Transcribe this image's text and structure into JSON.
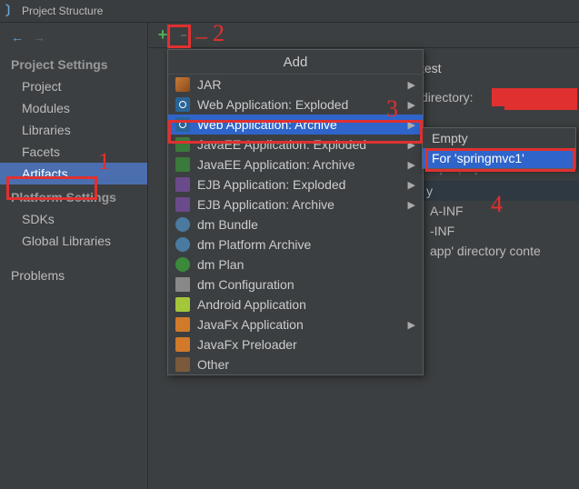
{
  "window": {
    "title": "Project Structure"
  },
  "sidebar": {
    "section1": "Project Settings",
    "items1": [
      "Project",
      "Modules",
      "Libraries",
      "Facets",
      "Artifacts"
    ],
    "section2": "Platform Settings",
    "items2": [
      "SDKs",
      "Global Libraries"
    ],
    "problems": "Problems"
  },
  "toolbar": {
    "plus": "+"
  },
  "popup": {
    "title": "Add",
    "items": [
      {
        "label": "JAR",
        "icon": "jar",
        "arrow": true
      },
      {
        "label": "Web Application: Exploded",
        "icon": "web",
        "arrow": true
      },
      {
        "label": "Web Application: Archive",
        "icon": "web",
        "arrow": true,
        "selected": true
      },
      {
        "label": "JavaEE Application: Exploded",
        "icon": "javaee",
        "arrow": true
      },
      {
        "label": "JavaEE Application: Archive",
        "icon": "javaee",
        "arrow": true
      },
      {
        "label": "EJB Application: Exploded",
        "icon": "ejb",
        "arrow": true
      },
      {
        "label": "EJB Application: Archive",
        "icon": "ejb",
        "arrow": true
      },
      {
        "label": "dm Bundle",
        "icon": "dm"
      },
      {
        "label": "dm Platform Archive",
        "icon": "dm"
      },
      {
        "label": "dm Plan",
        "icon": "dmp"
      },
      {
        "label": "dm Configuration",
        "icon": "file"
      },
      {
        "label": "Android Application",
        "icon": "and"
      },
      {
        "label": "JavaFx Application",
        "icon": "fx",
        "arrow": true
      },
      {
        "label": "JavaFx Preloader",
        "icon": "fx"
      },
      {
        "label": "Other",
        "icon": "other"
      }
    ]
  },
  "submenu": {
    "items": [
      {
        "label": "Empty"
      },
      {
        "label": "For 'springmvc1'",
        "selected": true
      }
    ]
  },
  "right": {
    "row1": "test",
    "dir_label": "directory:",
    "tree_header": "y",
    "tree_items": [
      "A-INF",
      "-INF",
      "app' directory conte"
    ]
  },
  "annotations": {
    "n1": "1",
    "n2": "2",
    "n3": "3",
    "n4": "4"
  }
}
